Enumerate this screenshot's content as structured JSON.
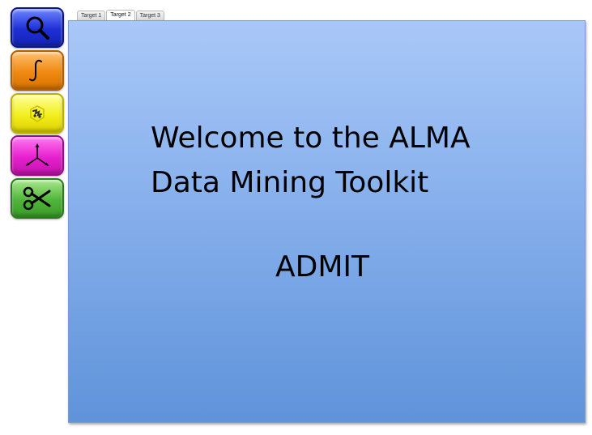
{
  "toolbar": {
    "tools": [
      {
        "name": "search",
        "icon": "magnifier-icon",
        "color": "#1d2fd6"
      },
      {
        "name": "integral",
        "icon": "integral-icon",
        "color": "#f08a10"
      },
      {
        "name": "moment",
        "icon": "moment-map-icon",
        "color": "#f3ef1e"
      },
      {
        "name": "axes",
        "icon": "axes-icon",
        "color": "#e720cf"
      },
      {
        "name": "cut",
        "icon": "scissors-icon",
        "color": "#4fb53a"
      }
    ]
  },
  "tabs": [
    {
      "label": "Target 1",
      "active": false
    },
    {
      "label": "Target 2",
      "active": true
    },
    {
      "label": "Target 3",
      "active": false
    }
  ],
  "welcome": {
    "line1": "Welcome to the ALMA",
    "line2": "Data Mining Toolkit",
    "acronym": "ADMIT"
  },
  "colors": {
    "panel_top": "#a9c8f8",
    "panel_bottom": "#5f93da"
  }
}
